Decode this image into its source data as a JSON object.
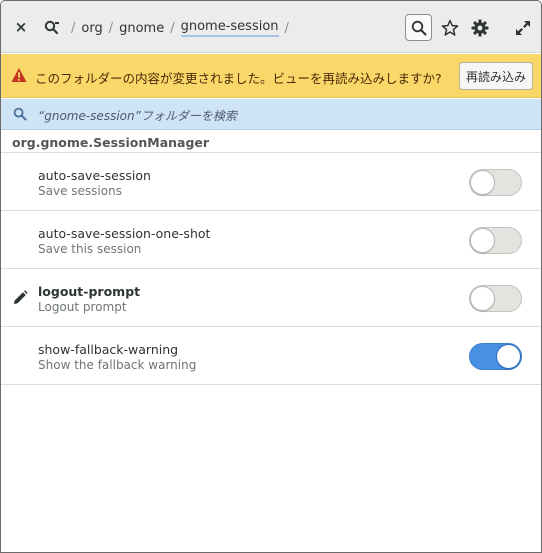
{
  "header": {
    "close_label": "×",
    "breadcrumbs": [
      {
        "label": "org"
      },
      {
        "label": "gnome"
      },
      {
        "label": "gnome-session"
      }
    ],
    "separator": "/",
    "icons": {
      "close": "close-icon",
      "path_search": "search-path-icon",
      "search": "search-icon",
      "bookmark": "star-icon",
      "settings": "gear-icon",
      "fullscreen": "expand-icon"
    }
  },
  "infobar": {
    "message": "このフォルダーの内容が変更されました。ビューを再読み込みしますか?",
    "reload_label": "再読み込み",
    "icon": "warning-icon"
  },
  "search": {
    "placeholder": "“gnome-session”フォルダーを検索"
  },
  "schema": {
    "title": "org.gnome.SessionManager"
  },
  "keys": [
    {
      "name": "auto-save-session",
      "description": "Save sessions",
      "value": false,
      "modified": false
    },
    {
      "name": "auto-save-session-one-shot",
      "description": "Save this session",
      "value": false,
      "modified": false
    },
    {
      "name": "logout-prompt",
      "description": "Logout prompt",
      "value": false,
      "modified": true
    },
    {
      "name": "show-fallback-warning",
      "description": "Show the fallback warning",
      "value": true,
      "modified": false
    }
  ],
  "colors": {
    "accent": "#4a90e2",
    "infobar": "#f9d769",
    "searchbar": "#cfe3f7"
  }
}
